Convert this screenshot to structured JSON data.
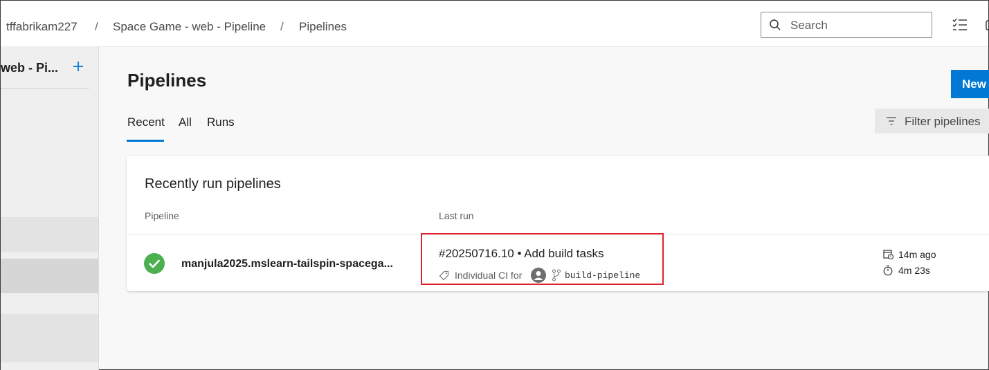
{
  "header": {
    "breadcrumb": [
      "tffabrikam227",
      "Space Game - web - Pipeline",
      "Pipelines"
    ],
    "separator": "/",
    "search_placeholder": "Search"
  },
  "sidebar": {
    "project_name": "web - Pi...",
    "add_icon": "plus-icon"
  },
  "main": {
    "title": "Pipelines",
    "new_button": "New",
    "tabs": [
      "Recent",
      "All",
      "Runs"
    ],
    "active_tab": "Recent",
    "filter_label": "Filter pipelines"
  },
  "card": {
    "title": "Recently run pipelines",
    "columns": [
      "Pipeline",
      "Last run"
    ],
    "rows": [
      {
        "status": "succeeded",
        "pipeline": "manjula2025.mslearn-tailspin-spacega...",
        "run_title": "#20250716.10 • Add build tasks",
        "reason": "Individual CI for",
        "branch": "build-pipeline",
        "ago": "14m ago",
        "duration": "4m 23s"
      }
    ]
  },
  "colors": {
    "accent": "#0078d4",
    "success": "#4caf50",
    "highlight": "#e0212b"
  }
}
